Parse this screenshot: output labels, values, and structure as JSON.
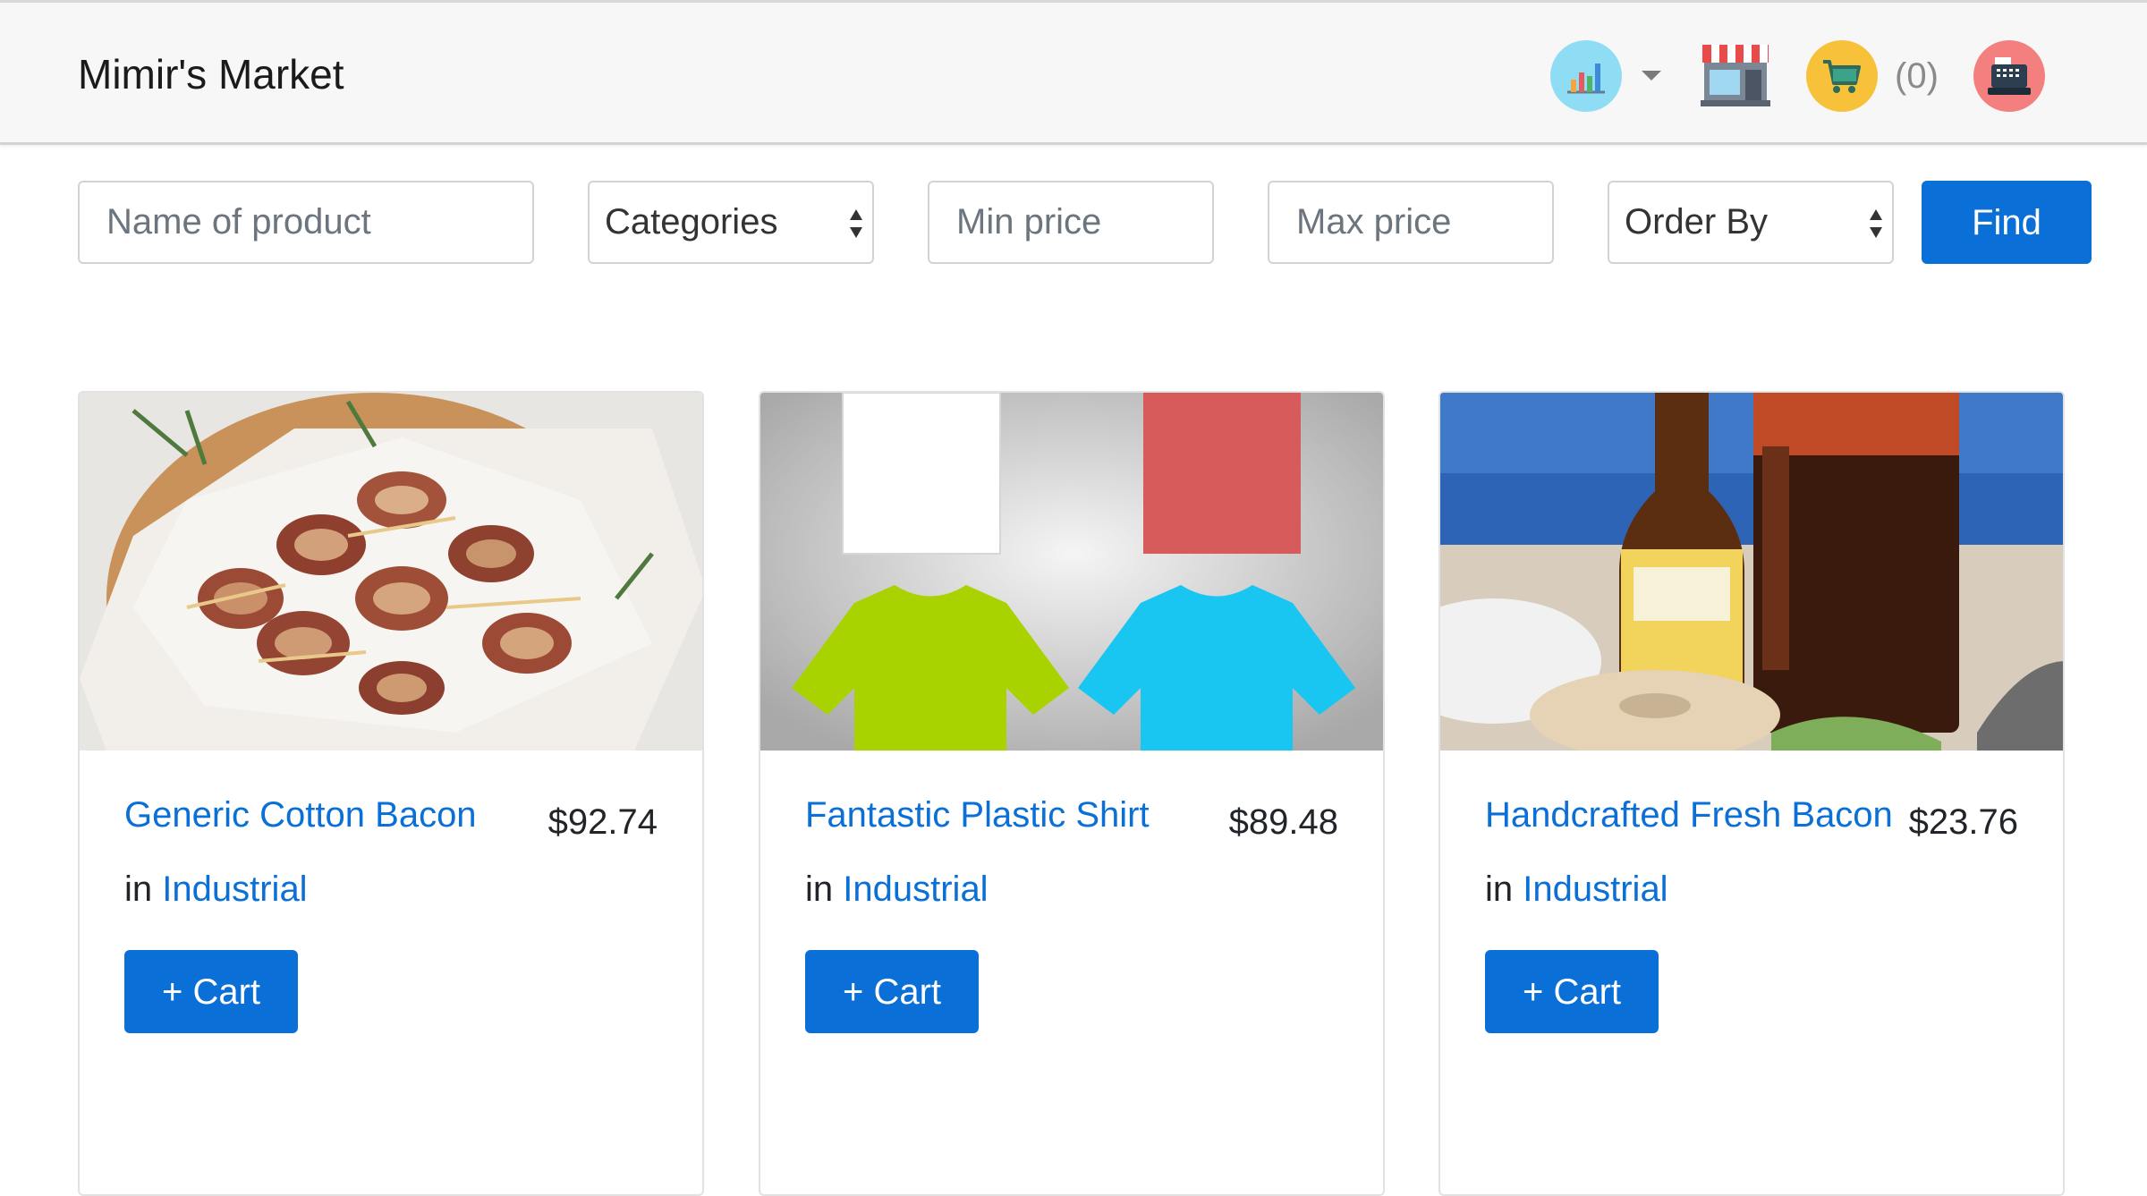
{
  "header": {
    "brand": "Mimir's Market",
    "cart_count": "(0)",
    "icons": [
      "analytics-icon",
      "caret-down-icon",
      "storefront-icon",
      "shopping-cart-icon",
      "cash-register-icon"
    ],
    "icon_colors": {
      "analytics": "#8fdcf5",
      "cart": "#f7c23a",
      "register": "#f47f7f"
    }
  },
  "filters": {
    "name_placeholder": "Name of product",
    "categories_label": "Categories",
    "min_price_placeholder": "Min price",
    "max_price_placeholder": "Max price",
    "order_by_label": "Order By",
    "find_label": "Find"
  },
  "products": [
    {
      "name": "Generic Cotton Bacon",
      "price": "$92.74",
      "in_label": "in",
      "category": "Industrial",
      "cart_label": "+ Cart",
      "image": "bacon-skewers-image"
    },
    {
      "name": "Fantastic Plastic Shirt",
      "price": "$89.48",
      "in_label": "in",
      "category": "Industrial",
      "cart_label": "+ Cart",
      "image": "tshirts-image"
    },
    {
      "name": "Handcrafted Fresh Bacon",
      "price": "$23.76",
      "in_label": "in",
      "category": "Industrial",
      "cart_label": "+ Cart",
      "image": "beer-and-bagel-image"
    }
  ],
  "theme": {
    "accent": "#0a6fd6",
    "navbar_bg": "#f7f7f7"
  }
}
